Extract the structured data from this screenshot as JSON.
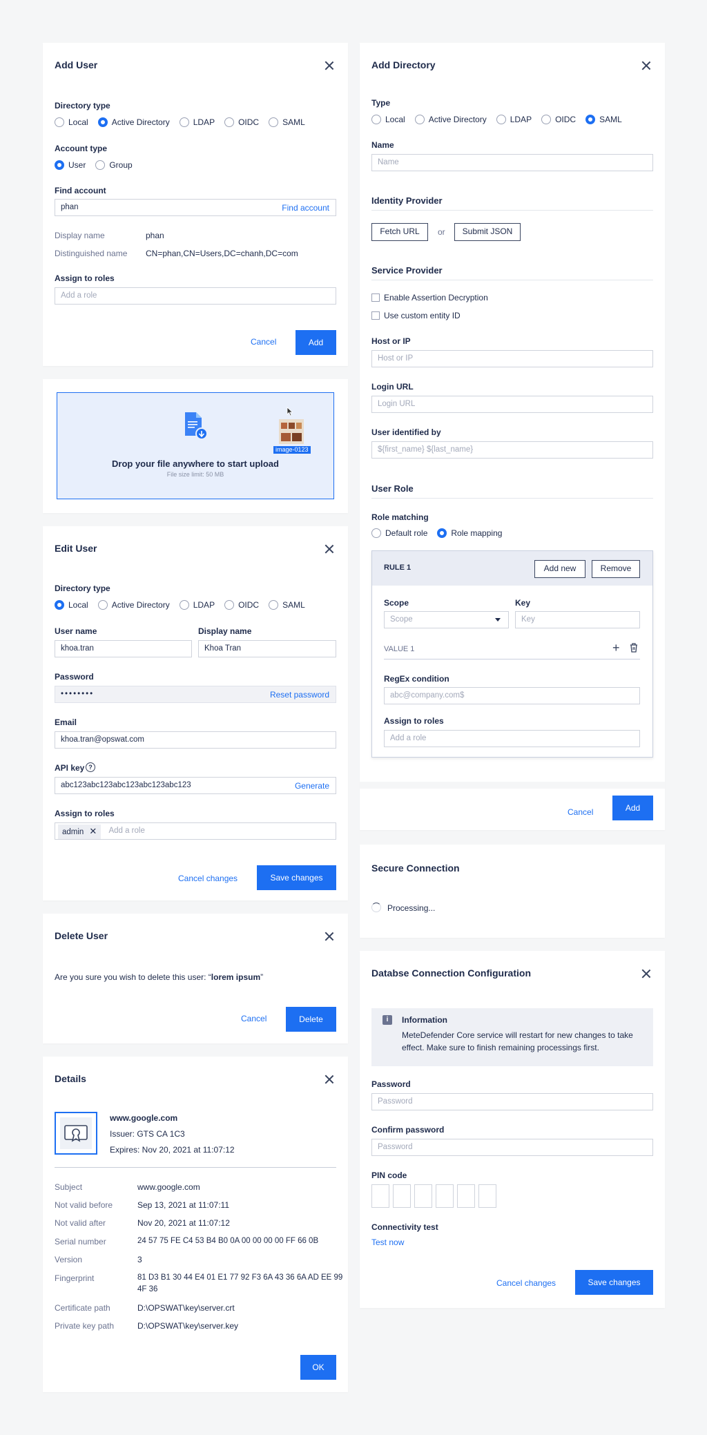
{
  "add_user": {
    "title": "Add User",
    "directory_type_label": "Directory type",
    "directory_types": [
      "Local",
      "Active Directory",
      "LDAP",
      "OIDC",
      "SAML"
    ],
    "account_type_label": "Account type",
    "account_types": [
      "User",
      "Group"
    ],
    "find_account_label": "Find account",
    "find_account_value": "phan",
    "find_account_link": "Find account",
    "display_name_label": "Display name",
    "display_name_value": "phan",
    "dn_label": "Distinguished name",
    "dn_value": "CN=phan,CN=Users,DC=chanh,DC=com",
    "roles_label": "Assign to roles",
    "roles_placeholder": "Add a role",
    "cancel": "Cancel",
    "add": "Add"
  },
  "upload": {
    "text": "Drop your file anywhere to start upload",
    "limit": "File size limit: 50 MB",
    "file_name": "image-0123"
  },
  "edit_user": {
    "title": "Edit User",
    "directory_type_label": "Directory type",
    "directory_types": [
      "Local",
      "Active Directory",
      "LDAP",
      "OIDC",
      "SAML"
    ],
    "username_label": "User name",
    "username_value": "khoa.tran",
    "display_name_label": "Display name",
    "display_name_value": "Khoa Tran",
    "password_label": "Password",
    "password_value": "••••••••",
    "reset_password": "Reset password",
    "email_label": "Email",
    "email_value": "khoa.tran@opswat.com",
    "api_key_label": "API key",
    "api_key_value": "abc123abc123abc123abc123abc123",
    "generate": "Generate",
    "roles_label": "Assign to roles",
    "role_tag": "admin",
    "roles_placeholder": "Add a role",
    "cancel": "Cancel changes",
    "save": "Save changes"
  },
  "delete_user": {
    "title": "Delete User",
    "message_prefix": "Are you sure you wish to delete this user: “",
    "message_name": "lorem ipsum",
    "message_suffix": "”",
    "cancel": "Cancel",
    "delete": "Delete"
  },
  "details": {
    "title": "Details",
    "cert_name": "www.google.com",
    "issuer": "Issuer: GTS CA 1C3",
    "expires": "Expires: Nov 20, 2021 at 11:07:12",
    "rows": [
      {
        "k": "Subject",
        "v": "www.google.com"
      },
      {
        "k": "Not valid before",
        "v": "Sep 13, 2021 at 11:07:11"
      },
      {
        "k": "Not valid after",
        "v": "Nov 20, 2021 at 11:07:12"
      },
      {
        "k": "Serial number",
        "v": "24 57 75 FE C4 53 B4 B0 0A 00 00 00 00 FF 66 0B"
      },
      {
        "k": "Version",
        "v": "3"
      },
      {
        "k": "Fingerprint",
        "v": "81 D3 B1 30 44 E4 01 E1 77 92 F3 6A 43 36 6A AD EE 99",
        "v2": "4F 36"
      },
      {
        "k": "Certificate path",
        "v": "D:\\OPSWAT\\key\\server.crt"
      },
      {
        "k": "Private key path",
        "v": "D:\\OPSWAT\\key\\server.key"
      }
    ],
    "ok": "OK"
  },
  "add_directory": {
    "title": "Add Directory",
    "type_label": "Type",
    "types": [
      "Local",
      "Active Directory",
      "LDAP",
      "OIDC",
      "SAML"
    ],
    "name_label": "Name",
    "name_placeholder": "Name",
    "idp_title": "Identity Provider",
    "fetch_url": "Fetch URL",
    "or": "or",
    "submit_json": "Submit JSON",
    "sp_title": "Service Provider",
    "enable_decryption": "Enable Assertion Decryption",
    "custom_entity": "Use custom entity ID",
    "host_label": "Host or IP",
    "host_placeholder": "Host or IP",
    "login_label": "Login URL",
    "login_placeholder": "Login URL",
    "user_id_label": "User identified by",
    "user_id_placeholder": "${first_name} ${last_name}",
    "role_title": "User Role",
    "role_matching_label": "Role matching",
    "role_matching": [
      "Default role",
      "Role mapping"
    ],
    "rule_title": "RULE 1",
    "add_new": "Add new",
    "remove": "Remove",
    "scope_label": "Scope",
    "scope_placeholder": "Scope",
    "key_label": "Key",
    "key_placeholder": "Key",
    "value_label": "VALUE 1",
    "regex_label": "RegEx condition",
    "regex_placeholder": "abc@company.com$",
    "roles_label": "Assign to roles",
    "roles_placeholder": "Add a role",
    "cancel": "Cancel",
    "add": "Add"
  },
  "secure_connection": {
    "title": "Secure Connection",
    "status": "Processing..."
  },
  "db_config": {
    "title": "Databse Connection Configuration",
    "info_title": "Information",
    "info_text_1": "MeteDefender Core service will restart for new changes to take",
    "info_text_2": "effect. Make sure to finish remaining processings first.",
    "password_label": "Password",
    "password_placeholder": "Password",
    "confirm_label": "Confirm password",
    "confirm_placeholder": "Password",
    "pin_label": "PIN code",
    "conn_label": "Connectivity test",
    "test_now": "Test now",
    "cancel": "Cancel changes",
    "save": "Save changes"
  },
  "colors": {
    "accent": "#1d6ff2",
    "upload_bg": "#e8effc"
  }
}
